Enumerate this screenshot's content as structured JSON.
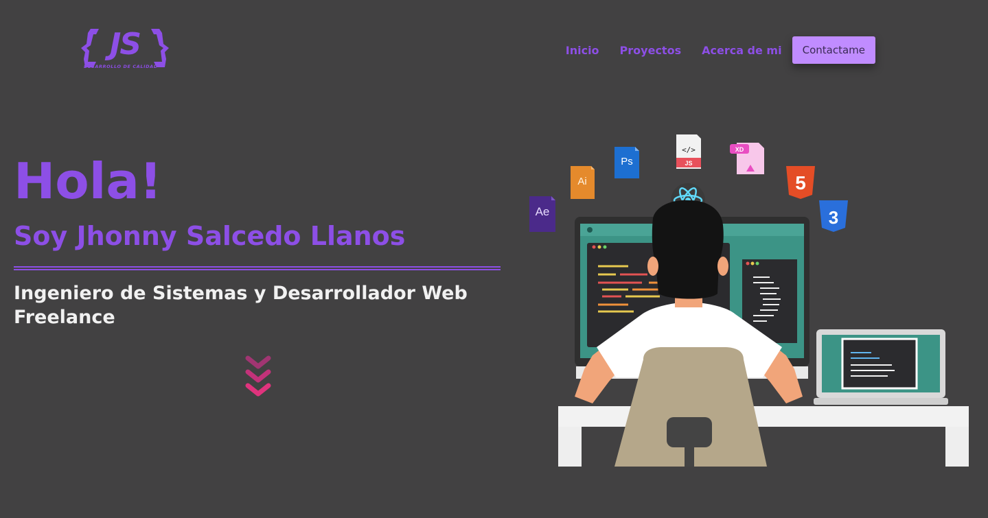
{
  "header": {
    "logo_text": "JS",
    "logo_subtitle": "DESARROLLO DE CALIDAD",
    "nav": [
      {
        "label": "Inicio"
      },
      {
        "label": "Proyectos"
      },
      {
        "label": "Acerca de mi"
      }
    ],
    "contact_button": "Contactame"
  },
  "hero": {
    "greeting": "Hola!",
    "name": "Soy Jhonny Salcedo Llanos",
    "role": "Ingeniero de Sistemas y Desarrollador Web Freelance",
    "scroll_icon": "chevrons-down-icon"
  },
  "illustration": {
    "tech_badges": [
      {
        "icon": "after-effects-icon",
        "label": "Ae",
        "color": "#4b2a8a"
      },
      {
        "icon": "illustrator-icon",
        "label": "Ai",
        "color": "#e58a2c"
      },
      {
        "icon": "photoshop-icon",
        "label": "Ps",
        "color": "#1d6fd1"
      },
      {
        "icon": "javascript-file-icon",
        "label": "JS",
        "color": "#e8505b"
      },
      {
        "icon": "adobe-xd-icon",
        "label": "XD",
        "color": "#e94ec2"
      },
      {
        "icon": "html5-icon",
        "label": "5",
        "color": "#e44d26"
      },
      {
        "icon": "css3-icon",
        "label": "3",
        "color": "#2a6fdb"
      },
      {
        "icon": "react-icon",
        "label": "",
        "color": "#61dafb"
      }
    ]
  },
  "colors": {
    "background": "#424142",
    "accent": "#8d4fe6",
    "button_bg": "#c08cff",
    "chevron": "#e0337d"
  }
}
